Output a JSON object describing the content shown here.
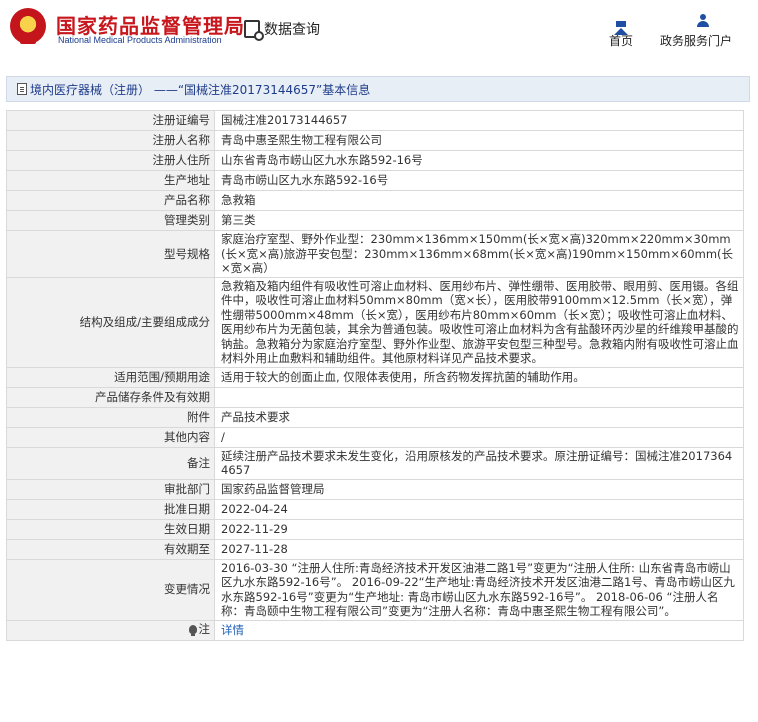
{
  "header": {
    "brand_cn": "国家药品监督管理局",
    "brand_en": "National Medical Products Administration",
    "query_label": "数据查询",
    "nav": {
      "home": "首页",
      "service": "政务服务门户"
    }
  },
  "breadcrumb": "境内医疗器械（注册） ——“国械注准20173144657”基本信息",
  "rows": [
    {
      "k": "注册证编号",
      "v": "国械注准20173144657"
    },
    {
      "k": "注册人名称",
      "v": "青岛中惠圣熙生物工程有限公司"
    },
    {
      "k": "注册人住所",
      "v": "山东省青岛市崂山区九水东路592-16号"
    },
    {
      "k": "生产地址",
      "v": "青岛市崂山区九水东路592-16号"
    },
    {
      "k": "产品名称",
      "v": "急救箱"
    },
    {
      "k": "管理类别",
      "v": "第三类"
    },
    {
      "k": "型号规格",
      "v": "家庭治疗室型、野外作业型：230mm×136mm×150mm(长×宽×高)320mm×220mm×30mm(长×宽×高)旅游平安包型：230mm×136mm×68mm(长×宽×高)190mm×150mm×60mm(长×宽×高）"
    },
    {
      "k": "结构及组成/主要组成成分",
      "v": "急救箱及箱内组件有吸收性可溶止血材料、医用纱布片、弹性绷带、医用胶带、眼用剪、医用镊。各组件中，吸收性可溶止血材料50mm×80mm（宽×长），医用胶带9100mm×12.5mm（长×宽），弹性绷带5000mm×48mm（长×宽），医用纱布片80mm×60mm（长×宽）；吸收性可溶止血材料、医用纱布片为无菌包装，其余为普通包装。吸收性可溶止血材料为含有盐酸环丙沙星的纤维羧甲基酸的钠盐。急救箱分为家庭治疗室型、野外作业型、旅游平安包型三种型号。急救箱内附有吸收性可溶止血材料外用止血敷料和辅助组件。其他原材料详见产品技术要求。"
    },
    {
      "k": "适用范围/预期用途",
      "v": "适用于较大的创面止血, 仅限体表使用，所含药物发挥抗菌的辅助作用。"
    },
    {
      "k": "产品储存条件及有效期",
      "v": ""
    },
    {
      "k": "附件",
      "v": "产品技术要求"
    },
    {
      "k": "其他内容",
      "v": "/"
    },
    {
      "k": "备注",
      "v": "延续注册产品技术要求未发生变化，沿用原核发的产品技术要求。原注册证编号：国械注准20173644657"
    },
    {
      "k": "审批部门",
      "v": "国家药品监督管理局"
    },
    {
      "k": "批准日期",
      "v": "2022-04-24"
    },
    {
      "k": "生效日期",
      "v": "2022-11-29"
    },
    {
      "k": "有效期至",
      "v": "2027-11-28"
    },
    {
      "k": "变更情况",
      "v": "2016-03-30 “注册人住所:青岛经济技术开发区油港二路1号”变更为“注册人住所: 山东省青岛市崂山区九水东路592-16号”。 2016-09-22“生产地址:青岛经济技术开发区油港二路1号、青岛市崂山区九水东路592-16号”变更为“生产地址: 青岛市崂山区九水东路592-16号”。 2018-06-06 “注册人名称：青岛颐中生物工程有限公司”变更为“注册人名称：青岛中惠圣熙生物工程有限公司”。"
    }
  ],
  "note": {
    "k": "注",
    "v": "详情"
  },
  "icons": [
    "emblem-logo",
    "query-icon",
    "home-icon",
    "person-icon",
    "document-icon",
    "bulb-icon"
  ],
  "colors": {
    "brand_red": "#c8161d",
    "nav_blue": "#1e4fa3",
    "link_blue": "#1e5fb4",
    "key_bg": "#f1f1f1",
    "crumb_bg": "#e8eef6"
  }
}
